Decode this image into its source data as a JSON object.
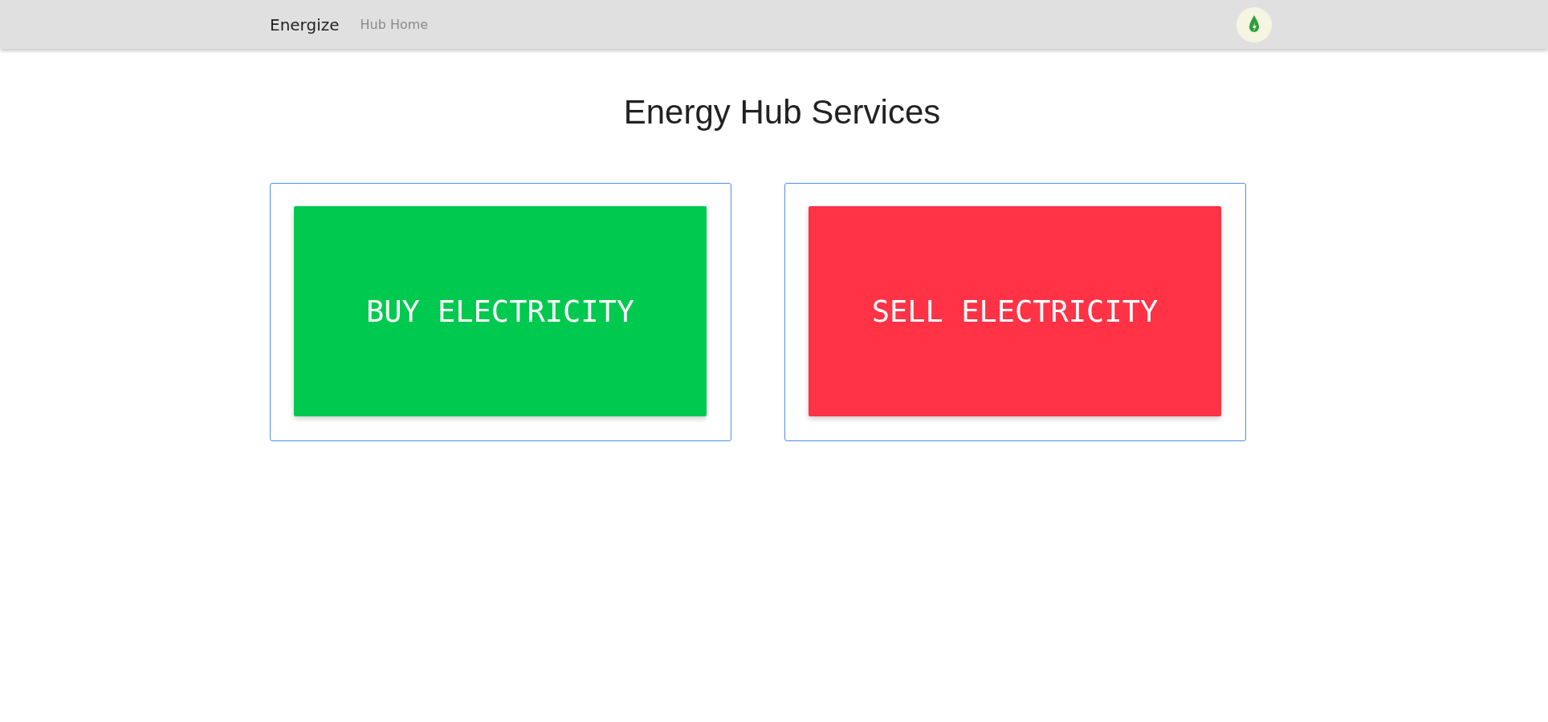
{
  "navbar": {
    "brand": "Energize",
    "links": [
      "Hub Home"
    ]
  },
  "title": "Energy Hub Services",
  "services": [
    {
      "label": "BUY ELECTRICITY",
      "color": "#00c94f"
    },
    {
      "label": "SELL ELECTRICITY",
      "color": "#ff3246"
    }
  ]
}
